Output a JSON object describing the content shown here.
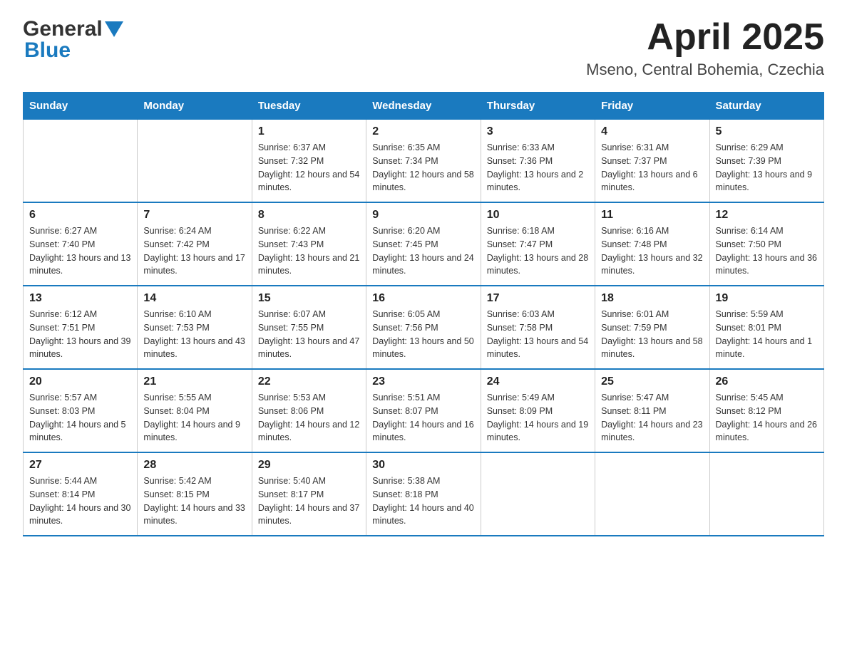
{
  "header": {
    "logo_general": "General",
    "logo_blue": "Blue",
    "title": "April 2025",
    "subtitle": "Mseno, Central Bohemia, Czechia"
  },
  "weekdays": [
    "Sunday",
    "Monday",
    "Tuesday",
    "Wednesday",
    "Thursday",
    "Friday",
    "Saturday"
  ],
  "weeks": [
    [
      {
        "day": "",
        "sunrise": "",
        "sunset": "",
        "daylight": ""
      },
      {
        "day": "",
        "sunrise": "",
        "sunset": "",
        "daylight": ""
      },
      {
        "day": "1",
        "sunrise": "Sunrise: 6:37 AM",
        "sunset": "Sunset: 7:32 PM",
        "daylight": "Daylight: 12 hours and 54 minutes."
      },
      {
        "day": "2",
        "sunrise": "Sunrise: 6:35 AM",
        "sunset": "Sunset: 7:34 PM",
        "daylight": "Daylight: 12 hours and 58 minutes."
      },
      {
        "day": "3",
        "sunrise": "Sunrise: 6:33 AM",
        "sunset": "Sunset: 7:36 PM",
        "daylight": "Daylight: 13 hours and 2 minutes."
      },
      {
        "day": "4",
        "sunrise": "Sunrise: 6:31 AM",
        "sunset": "Sunset: 7:37 PM",
        "daylight": "Daylight: 13 hours and 6 minutes."
      },
      {
        "day": "5",
        "sunrise": "Sunrise: 6:29 AM",
        "sunset": "Sunset: 7:39 PM",
        "daylight": "Daylight: 13 hours and 9 minutes."
      }
    ],
    [
      {
        "day": "6",
        "sunrise": "Sunrise: 6:27 AM",
        "sunset": "Sunset: 7:40 PM",
        "daylight": "Daylight: 13 hours and 13 minutes."
      },
      {
        "day": "7",
        "sunrise": "Sunrise: 6:24 AM",
        "sunset": "Sunset: 7:42 PM",
        "daylight": "Daylight: 13 hours and 17 minutes."
      },
      {
        "day": "8",
        "sunrise": "Sunrise: 6:22 AM",
        "sunset": "Sunset: 7:43 PM",
        "daylight": "Daylight: 13 hours and 21 minutes."
      },
      {
        "day": "9",
        "sunrise": "Sunrise: 6:20 AM",
        "sunset": "Sunset: 7:45 PM",
        "daylight": "Daylight: 13 hours and 24 minutes."
      },
      {
        "day": "10",
        "sunrise": "Sunrise: 6:18 AM",
        "sunset": "Sunset: 7:47 PM",
        "daylight": "Daylight: 13 hours and 28 minutes."
      },
      {
        "day": "11",
        "sunrise": "Sunrise: 6:16 AM",
        "sunset": "Sunset: 7:48 PM",
        "daylight": "Daylight: 13 hours and 32 minutes."
      },
      {
        "day": "12",
        "sunrise": "Sunrise: 6:14 AM",
        "sunset": "Sunset: 7:50 PM",
        "daylight": "Daylight: 13 hours and 36 minutes."
      }
    ],
    [
      {
        "day": "13",
        "sunrise": "Sunrise: 6:12 AM",
        "sunset": "Sunset: 7:51 PM",
        "daylight": "Daylight: 13 hours and 39 minutes."
      },
      {
        "day": "14",
        "sunrise": "Sunrise: 6:10 AM",
        "sunset": "Sunset: 7:53 PM",
        "daylight": "Daylight: 13 hours and 43 minutes."
      },
      {
        "day": "15",
        "sunrise": "Sunrise: 6:07 AM",
        "sunset": "Sunset: 7:55 PM",
        "daylight": "Daylight: 13 hours and 47 minutes."
      },
      {
        "day": "16",
        "sunrise": "Sunrise: 6:05 AM",
        "sunset": "Sunset: 7:56 PM",
        "daylight": "Daylight: 13 hours and 50 minutes."
      },
      {
        "day": "17",
        "sunrise": "Sunrise: 6:03 AM",
        "sunset": "Sunset: 7:58 PM",
        "daylight": "Daylight: 13 hours and 54 minutes."
      },
      {
        "day": "18",
        "sunrise": "Sunrise: 6:01 AM",
        "sunset": "Sunset: 7:59 PM",
        "daylight": "Daylight: 13 hours and 58 minutes."
      },
      {
        "day": "19",
        "sunrise": "Sunrise: 5:59 AM",
        "sunset": "Sunset: 8:01 PM",
        "daylight": "Daylight: 14 hours and 1 minute."
      }
    ],
    [
      {
        "day": "20",
        "sunrise": "Sunrise: 5:57 AM",
        "sunset": "Sunset: 8:03 PM",
        "daylight": "Daylight: 14 hours and 5 minutes."
      },
      {
        "day": "21",
        "sunrise": "Sunrise: 5:55 AM",
        "sunset": "Sunset: 8:04 PM",
        "daylight": "Daylight: 14 hours and 9 minutes."
      },
      {
        "day": "22",
        "sunrise": "Sunrise: 5:53 AM",
        "sunset": "Sunset: 8:06 PM",
        "daylight": "Daylight: 14 hours and 12 minutes."
      },
      {
        "day": "23",
        "sunrise": "Sunrise: 5:51 AM",
        "sunset": "Sunset: 8:07 PM",
        "daylight": "Daylight: 14 hours and 16 minutes."
      },
      {
        "day": "24",
        "sunrise": "Sunrise: 5:49 AM",
        "sunset": "Sunset: 8:09 PM",
        "daylight": "Daylight: 14 hours and 19 minutes."
      },
      {
        "day": "25",
        "sunrise": "Sunrise: 5:47 AM",
        "sunset": "Sunset: 8:11 PM",
        "daylight": "Daylight: 14 hours and 23 minutes."
      },
      {
        "day": "26",
        "sunrise": "Sunrise: 5:45 AM",
        "sunset": "Sunset: 8:12 PM",
        "daylight": "Daylight: 14 hours and 26 minutes."
      }
    ],
    [
      {
        "day": "27",
        "sunrise": "Sunrise: 5:44 AM",
        "sunset": "Sunset: 8:14 PM",
        "daylight": "Daylight: 14 hours and 30 minutes."
      },
      {
        "day": "28",
        "sunrise": "Sunrise: 5:42 AM",
        "sunset": "Sunset: 8:15 PM",
        "daylight": "Daylight: 14 hours and 33 minutes."
      },
      {
        "day": "29",
        "sunrise": "Sunrise: 5:40 AM",
        "sunset": "Sunset: 8:17 PM",
        "daylight": "Daylight: 14 hours and 37 minutes."
      },
      {
        "day": "30",
        "sunrise": "Sunrise: 5:38 AM",
        "sunset": "Sunset: 8:18 PM",
        "daylight": "Daylight: 14 hours and 40 minutes."
      },
      {
        "day": "",
        "sunrise": "",
        "sunset": "",
        "daylight": ""
      },
      {
        "day": "",
        "sunrise": "",
        "sunset": "",
        "daylight": ""
      },
      {
        "day": "",
        "sunrise": "",
        "sunset": "",
        "daylight": ""
      }
    ]
  ]
}
